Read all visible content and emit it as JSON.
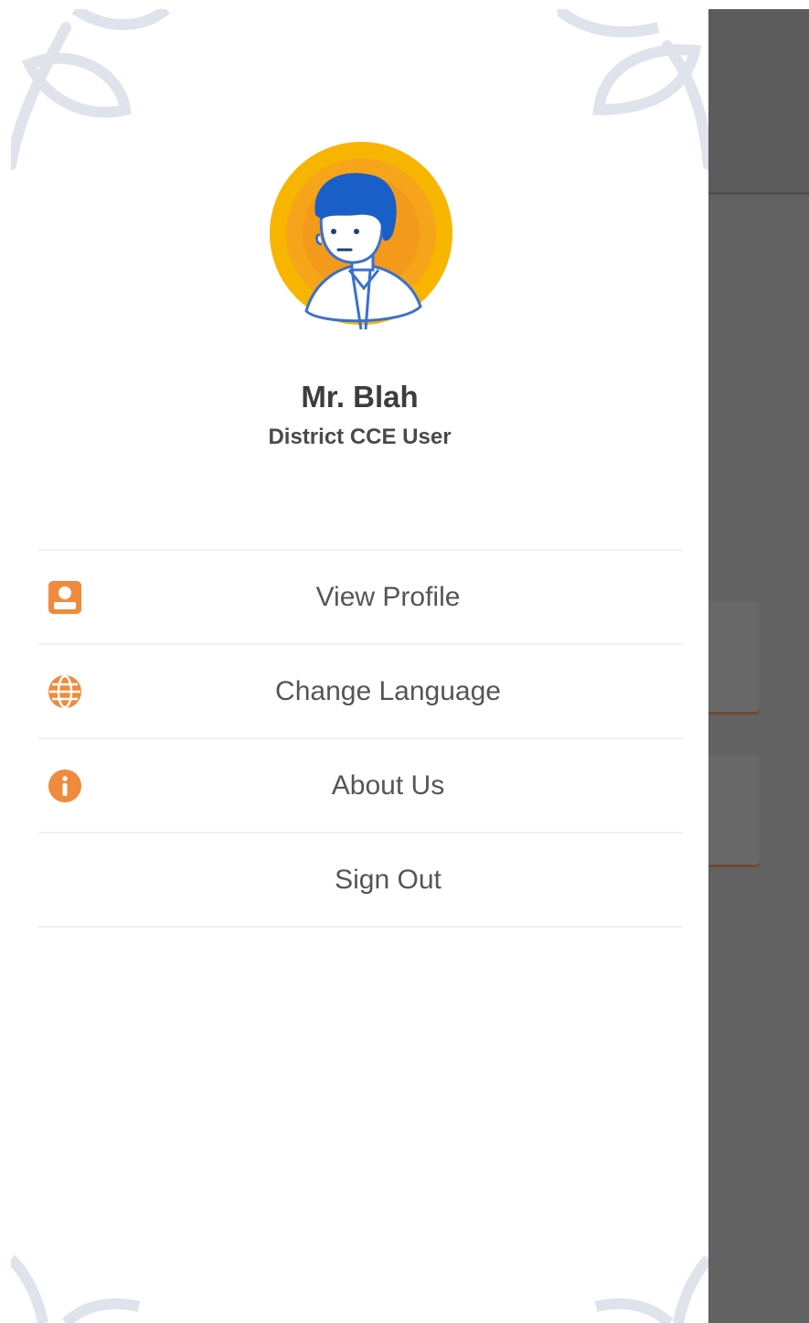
{
  "user": {
    "name": "Mr. Blah",
    "role": "District CCE User"
  },
  "menu": {
    "items": [
      {
        "label": "View Profile",
        "icon": "profile-icon"
      },
      {
        "label": "Change Language",
        "icon": "globe-icon"
      },
      {
        "label": "About Us",
        "icon": "info-icon"
      },
      {
        "label": "Sign Out",
        "icon": ""
      }
    ]
  },
  "colors": {
    "accent": "#f08a3c",
    "avatar_ring": "#f7b500",
    "avatar_inner": "#f39a1a",
    "avatar_hair": "#1a5fc8",
    "scrim": "#626262",
    "text": "#555555",
    "decoration": "#dfe3ec"
  }
}
